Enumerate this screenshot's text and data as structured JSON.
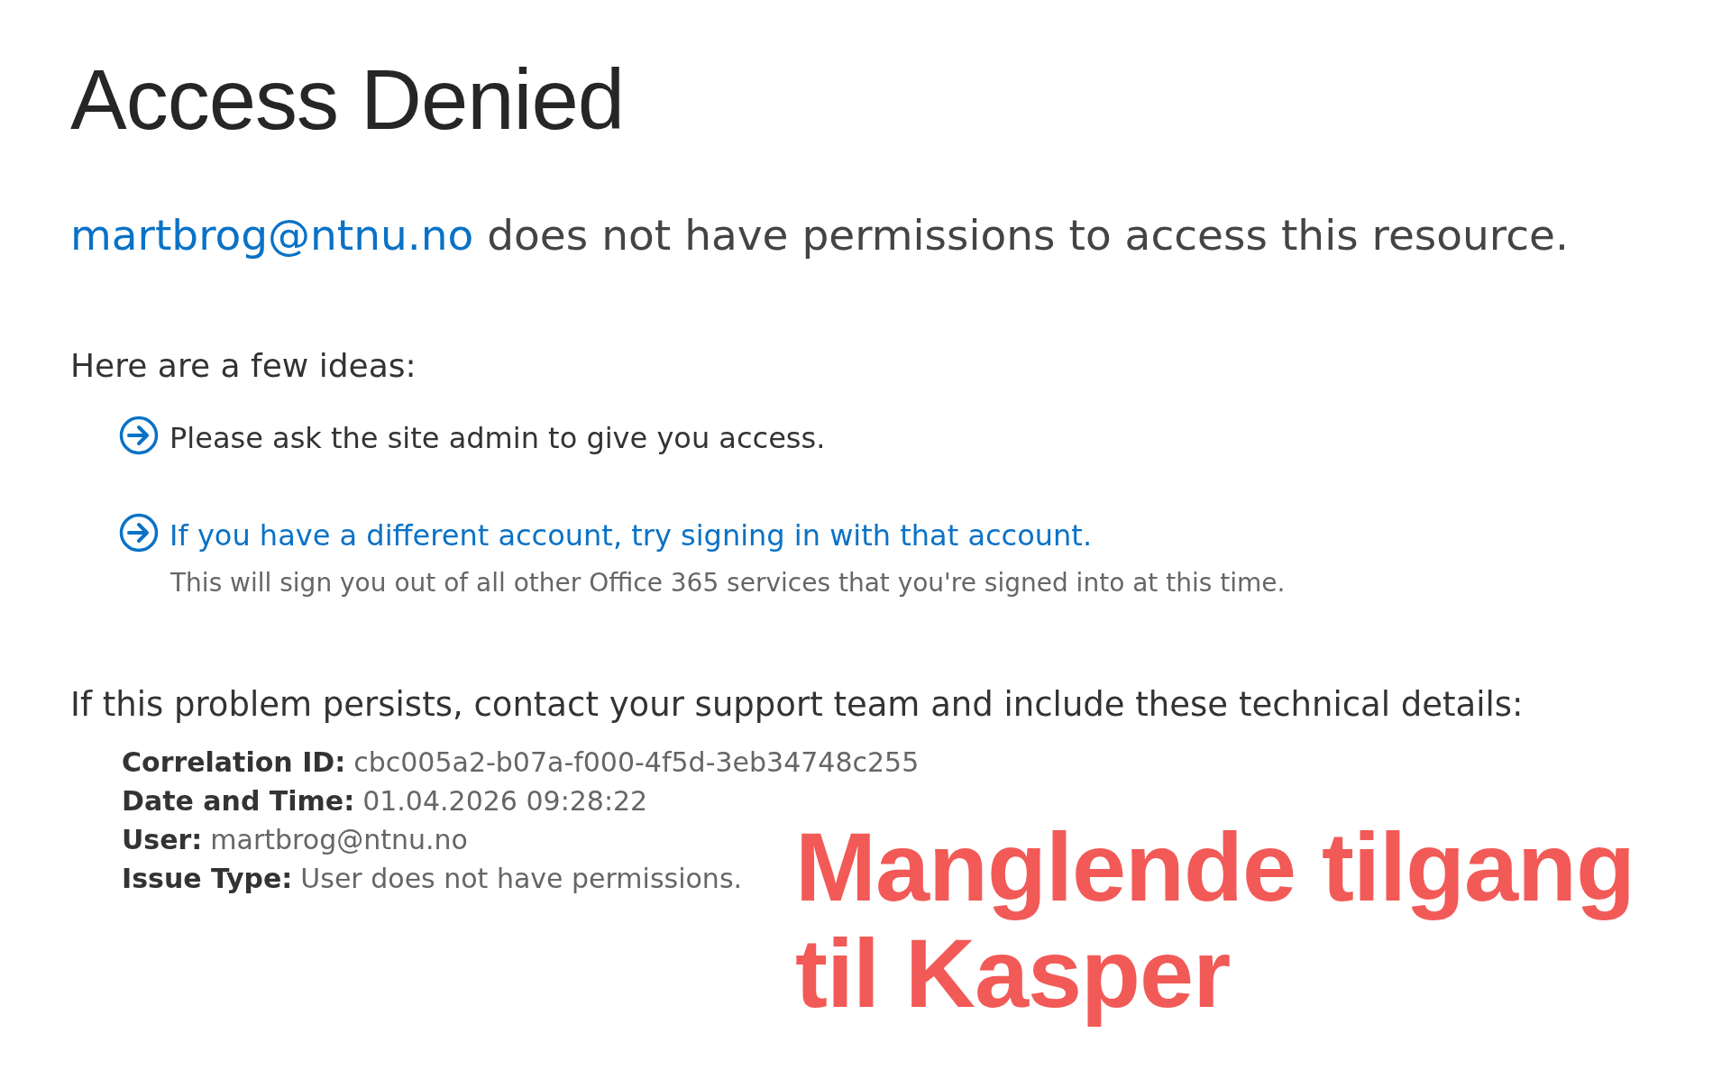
{
  "title": "Access Denied",
  "message": {
    "user": "martbrog@ntnu.no",
    "text": "does not have permissions to access this resource."
  },
  "ideas_heading": "Here are a few ideas:",
  "ideas": [
    {
      "kind": "text",
      "text": "Please ask the site admin to give you access."
    },
    {
      "kind": "link",
      "text": "If you have a different account, try signing in with that account.",
      "note": "This will sign you out of all other Office 365 services that you're signed into at this time."
    }
  ],
  "details_heading": "If this problem persists, contact your support team and include these technical details:",
  "details": [
    {
      "label": "Correlation ID:",
      "value": "cbc005a2-b07a-f000-4f5d-3eb34748c255"
    },
    {
      "label": "Date and Time:",
      "value": "01.04.2026 09:28:22"
    },
    {
      "label": "User:",
      "value": "martbrog@ntnu.no"
    },
    {
      "label": "Issue Type:",
      "value": "User does not have permissions."
    }
  ],
  "annotation": "Manglende tilgang til Kasper"
}
